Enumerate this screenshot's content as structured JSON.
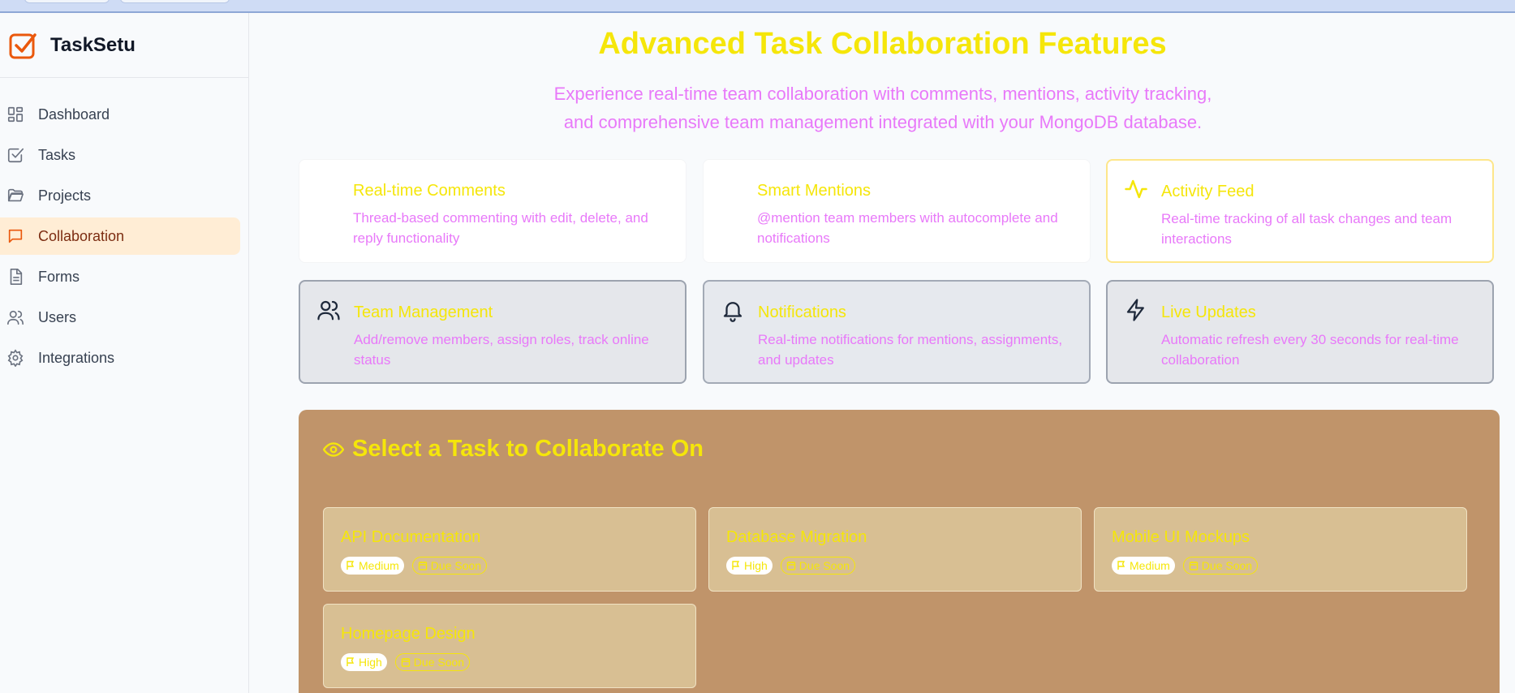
{
  "app": {
    "name": "TaskSetu"
  },
  "sidebar": {
    "items": [
      {
        "label": "Dashboard",
        "icon": "dashboard-icon",
        "active": false
      },
      {
        "label": "Tasks",
        "icon": "checkbox-icon",
        "active": false
      },
      {
        "label": "Projects",
        "icon": "folder-icon",
        "active": false
      },
      {
        "label": "Collaboration",
        "icon": "chat-icon",
        "active": true
      },
      {
        "label": "Forms",
        "icon": "document-icon",
        "active": false
      },
      {
        "label": "Users",
        "icon": "users-icon",
        "active": false
      },
      {
        "label": "Integrations",
        "icon": "gear-icon",
        "active": false
      }
    ]
  },
  "hero": {
    "title": "Advanced Task Collaboration Features",
    "subtitle": "Experience real-time team collaboration with comments, mentions, activity tracking, and comprehensive team management integrated with your MongoDB database."
  },
  "features": [
    {
      "title": "Real-time Comments",
      "desc": "Thread-based commenting with edit, delete, and reply functionality",
      "icon": ""
    },
    {
      "title": "Smart Mentions",
      "desc": "@mention team members with autocomplete and notifications",
      "icon": ""
    },
    {
      "title": "Activity Feed",
      "desc": "Real-time tracking of all task changes and team interactions",
      "icon": "activity-icon"
    },
    {
      "title": "Team Management",
      "desc": "Add/remove members, assign roles, track online status",
      "icon": "users-icon"
    },
    {
      "title": "Notifications",
      "desc": "Real-time notifications for mentions, assignments, and updates",
      "icon": "bell-icon"
    },
    {
      "title": "Live Updates",
      "desc": "Automatic refresh every 30 seconds for real-time collaboration",
      "icon": "lightning-icon"
    }
  ],
  "select_panel": {
    "title": "Select a Task to Collaborate On",
    "tasks": [
      {
        "name": "API Documentation",
        "priority": "Medium",
        "due": "Due Soon"
      },
      {
        "name": "Database Migration",
        "priority": "High",
        "due": "Due Soon"
      },
      {
        "name": "Mobile UI Mockups",
        "priority": "Medium",
        "due": "Due Soon"
      },
      {
        "name": "Homepage Design",
        "priority": "High",
        "due": "Due Soon"
      }
    ]
  },
  "colors": {
    "accent": "#ea580c",
    "title_yellow": "#f5e60a",
    "subtitle_pink": "#e879f9",
    "panel_brown": "#c0946a"
  }
}
